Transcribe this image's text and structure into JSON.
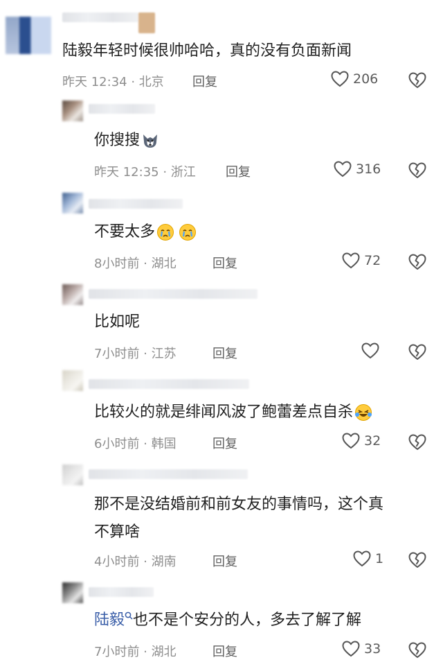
{
  "comments": [
    {
      "text": "陆毅年轻时候很帅哈哈，真的没有负面新闻",
      "time": "昨天 12:34 · 北京",
      "reply": "回复",
      "likes": "206"
    },
    {
      "text": "你搜搜",
      "emoji_icon": "husky-dog-face-icon",
      "time": "昨天 12:35 · 浙江",
      "reply": "回复",
      "likes": "316"
    },
    {
      "text": "不要太多",
      "emoji_icon": "crying-face-icon",
      "time": "8小时前 · 湖北",
      "reply": "回复",
      "likes": "72"
    },
    {
      "text": "比如呢",
      "time": "7小时前 · 江苏",
      "reply": "回复",
      "likes": ""
    },
    {
      "text": "比较火的就是绯闻风波了鲍蕾差点自杀",
      "emoji_icon": "laugh-cry-face-icon",
      "time": "6小时前 · 韩国",
      "reply": "回复",
      "likes": "32"
    },
    {
      "text": "那不是没结婚前和前女友的事情吗，这个真不算啥",
      "line1": "那不是没结婚前和前女友的事情吗，这个真",
      "line2": "不算啥",
      "time": "4小时前 · 湖南",
      "reply": "回复",
      "likes": "1"
    },
    {
      "mention": "陆毅",
      "text": "也不是个安分的人，多去了解了解",
      "time": "7小时前 · 湖北",
      "reply": "回复",
      "likes": "33"
    }
  ],
  "icons": {
    "like": "heart-outline-icon",
    "dislike": "broken-heart-icon",
    "search": "search-icon"
  }
}
